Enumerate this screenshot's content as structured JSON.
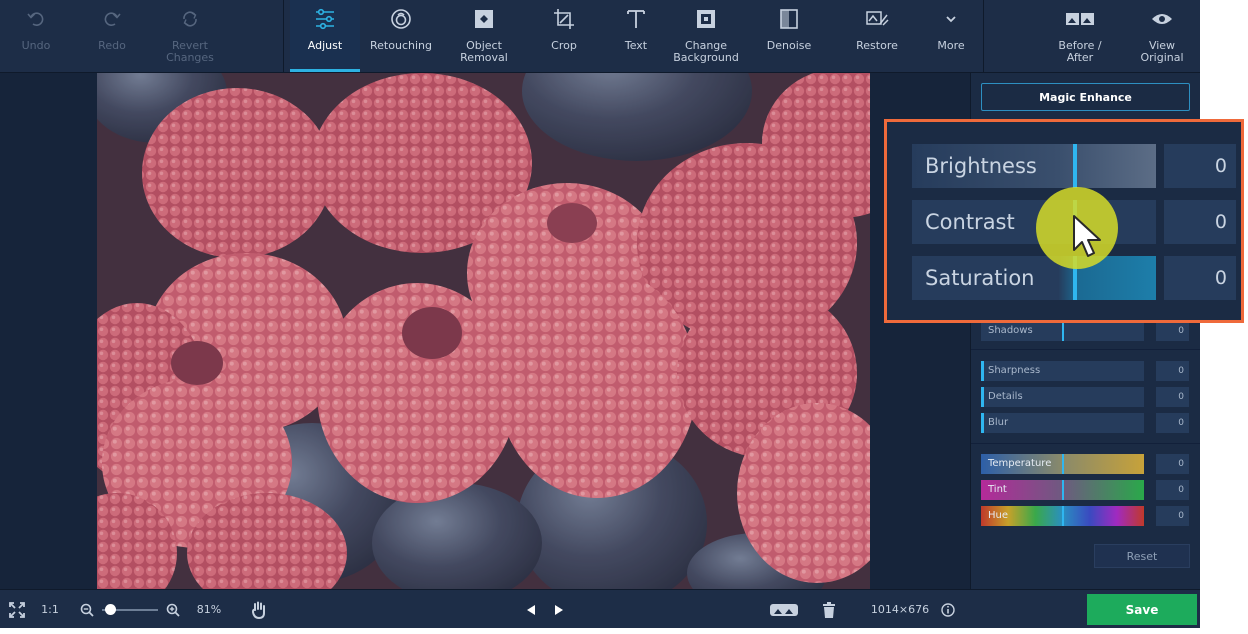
{
  "toolbar": {
    "undo": "Undo",
    "redo": "Redo",
    "revert": "Revert\nChanges",
    "adjust": "Adjust",
    "retouching": "Retouching",
    "object_removal": "Object\nRemoval",
    "crop": "Crop",
    "text": "Text",
    "change_background": "Change\nBackground",
    "denoise": "Denoise",
    "restore": "Restore",
    "more": "More",
    "before_after": "Before /\nAfter",
    "view_original": "View\nOriginal",
    "active_tab": "Adjust"
  },
  "panel": {
    "magic_enhance": "Magic Enhance",
    "sliders_main": [
      {
        "label": "Brightness",
        "value": "0"
      },
      {
        "label": "Contrast",
        "value": "0"
      },
      {
        "label": "Saturation",
        "value": "0"
      }
    ],
    "shadows": {
      "label": "Shadows",
      "value": "0"
    },
    "detail_sliders": [
      {
        "label": "Sharpness",
        "value": "0"
      },
      {
        "label": "Details",
        "value": "0"
      },
      {
        "label": "Blur",
        "value": "0"
      }
    ],
    "color_sliders": [
      {
        "label": "Temperature",
        "value": "0"
      },
      {
        "label": "Tint",
        "value": "0"
      },
      {
        "label": "Hue",
        "value": "0"
      }
    ],
    "reset": "Reset"
  },
  "bottom": {
    "one_to_one": "1:1",
    "zoom": "81%",
    "zoom_level": 0.15,
    "dimensions": "1014×676",
    "save": "Save"
  },
  "colors": {
    "accent": "#2fb6f0",
    "save": "#1dab5c",
    "highlight_border": "#ef6a3b",
    "cursor_halo": "#d6dc28"
  },
  "icons": [
    "undo-icon",
    "redo-icon",
    "revert-icon",
    "sliders-icon",
    "retouch-icon",
    "eraser-icon",
    "crop-icon",
    "text-icon",
    "background-icon",
    "denoise-icon",
    "restore-icon",
    "chevron-down-icon",
    "before-after-icon",
    "eye-icon",
    "fullscreen-icon",
    "zoom-out-icon",
    "zoom-in-icon",
    "hand-icon",
    "prev-icon",
    "next-icon",
    "compare-icon",
    "trash-icon",
    "info-icon",
    "cursor-icon"
  ]
}
